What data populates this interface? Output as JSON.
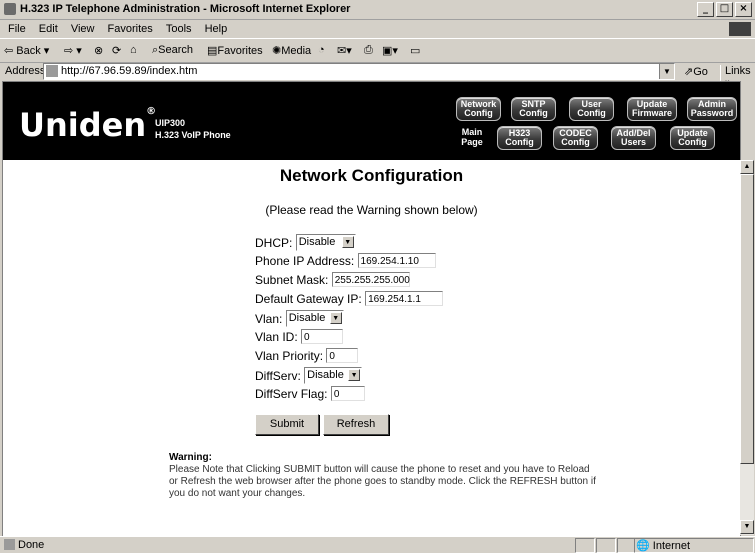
{
  "window": {
    "title": "H.323 IP Telephone Administration - Microsoft Internet Explorer",
    "min": "_",
    "max": "□",
    "close": "×"
  },
  "menu": [
    "File",
    "Edit",
    "View",
    "Favorites",
    "Tools",
    "Help"
  ],
  "toolbar": {
    "back": "Back",
    "search": "Search",
    "favorites": "Favorites",
    "media": "Media"
  },
  "address": {
    "label": "Address",
    "url": "http://67.96.59.89/index.htm",
    "go": "Go",
    "links": "Links »"
  },
  "header": {
    "logo": "Uniden",
    "logo_mark": "®",
    "model": "UIP300",
    "model_desc": "H.323 VoIP Phone",
    "nav_row1": [
      "Network Config",
      "SNTP Config",
      "User Config",
      "Update Firmware",
      "Admin Password"
    ],
    "nav_main_label": "Main Page",
    "nav_row2": [
      "H323 Config",
      "CODEC Config",
      "Add/Del Users",
      "Update Config"
    ]
  },
  "page": {
    "title": "Network Configuration",
    "subtitle": "(Please read the Warning shown below)"
  },
  "form": {
    "dhcp_label": "DHCP:",
    "dhcp_value": "Disable",
    "ip_label": "Phone IP Address:",
    "ip_value": "169.254.1.10",
    "mask_label": "Subnet Mask:",
    "mask_value": "255.255.255.000",
    "gateway_label": "Default Gateway IP:",
    "gateway_value": "169.254.1.1",
    "vlan_label": "Vlan:",
    "vlan_value": "Disable",
    "vlan_id_label": "Vlan ID:",
    "vlan_id_value": "0",
    "vlan_priority_label": "Vlan Priority:",
    "vlan_priority_value": "0",
    "diffserv_label": "DiffServ:",
    "diffserv_value": "Disable",
    "diffserv_flag_label": "DiffServ Flag:",
    "diffserv_flag_value": "0",
    "submit": "Submit",
    "refresh": "Refresh"
  },
  "warning": {
    "title": "Warning:",
    "text": "Please Note that Clicking SUBMIT button will cause the phone to reset and you have to Reload or Refresh the web browser after the phone goes to standby mode. Click the REFRESH button if you do not want your changes."
  },
  "status": {
    "text": "Done",
    "zone": "Internet"
  }
}
